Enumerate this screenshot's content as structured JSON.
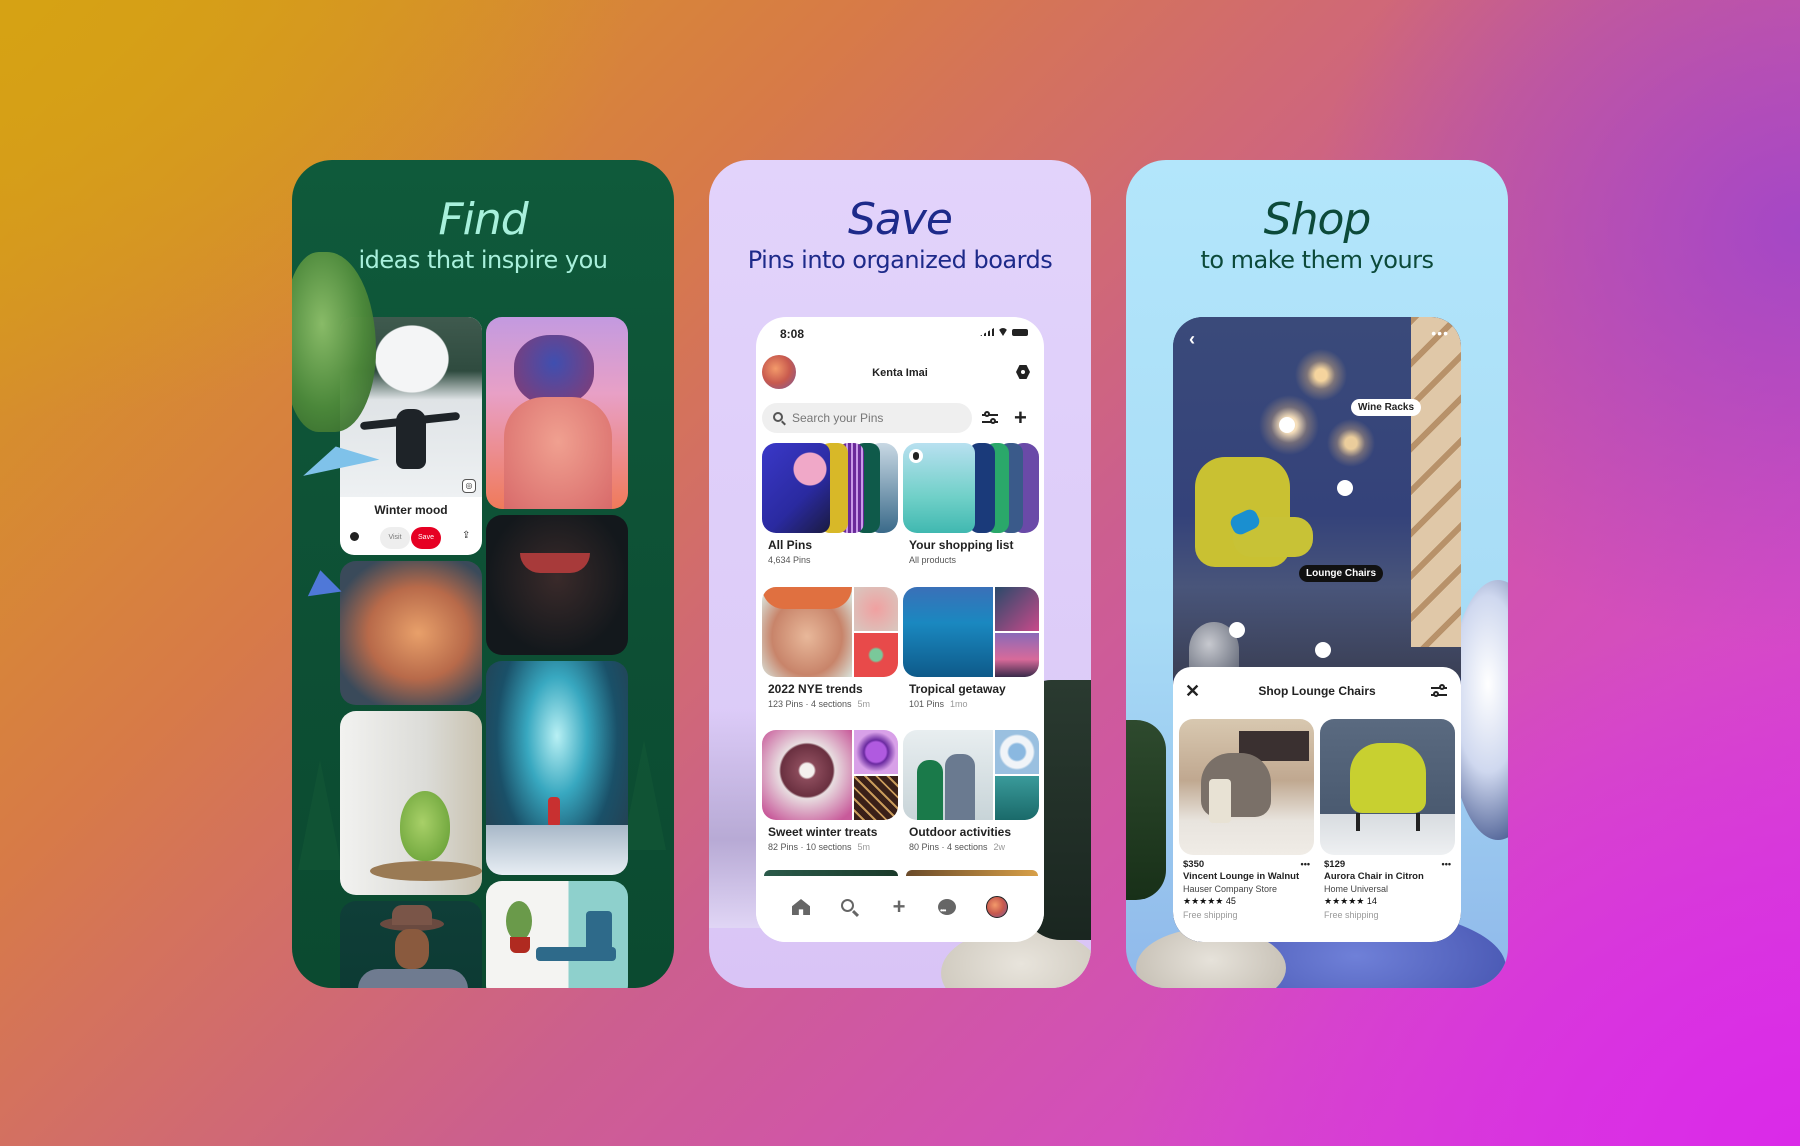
{
  "cards": {
    "find": {
      "title": "Find",
      "subtitle": "ideas that inspire you",
      "pin": {
        "title": "Winter mood",
        "visit_label": "Visit",
        "save_label": "Save",
        "lens_icon": "visual-search-icon",
        "chat_icon": "comment-icon",
        "share_icon": "share-icon"
      },
      "colors": {
        "background": "#0f5a3b",
        "title": "#a8f0dc",
        "save_button": "#e60023"
      }
    },
    "save": {
      "title": "Save",
      "subtitle": "Pins into organized boards",
      "status": {
        "time": "8:08"
      },
      "profile": {
        "name": "Kenta Imai"
      },
      "search": {
        "placeholder": "Search your Pins"
      },
      "boards": [
        {
          "name": "All Pins",
          "meta": "4,634 Pins",
          "age": ""
        },
        {
          "name": "Your shopping list",
          "meta": "All products",
          "age": ""
        },
        {
          "name": "2022 NYE trends",
          "meta": "123 Pins · 4 sections",
          "age": "5m"
        },
        {
          "name": "Tropical getaway",
          "meta": "101 Pins",
          "age": "1mo"
        },
        {
          "name": "Sweet winter treats",
          "meta": "82 Pins · 10 sections",
          "age": "5m"
        },
        {
          "name": "Outdoor activities",
          "meta": "80 Pins · 4 sections",
          "age": "2w"
        }
      ],
      "nav": [
        "home-icon",
        "search-icon",
        "plus-icon",
        "messages-icon",
        "profile-avatar"
      ],
      "colors": {
        "background": "#e2d3fb",
        "title": "#1d2a8a"
      }
    },
    "shop": {
      "title": "Shop",
      "subtitle": "to make them yours",
      "tags": {
        "wine_racks": "Wine Racks",
        "lounge_chairs": "Lounge Chairs"
      },
      "sheet": {
        "title": "Shop Lounge Chairs",
        "products": [
          {
            "price": "$350",
            "name": "Vincent Lounge in Walnut",
            "store": "Hauser Company Store",
            "stars": "★★★★★",
            "rating": 5,
            "reviews": "45",
            "shipping": "Free shipping"
          },
          {
            "price": "$129",
            "name": "Aurora Chair in Citron",
            "store": "Home Universal",
            "stars": "★★★★★",
            "rating": 4.5,
            "reviews": "14",
            "shipping": "Free shipping"
          }
        ]
      },
      "colors": {
        "background": "#b3e6fb",
        "title": "#0c4a3a"
      }
    }
  }
}
